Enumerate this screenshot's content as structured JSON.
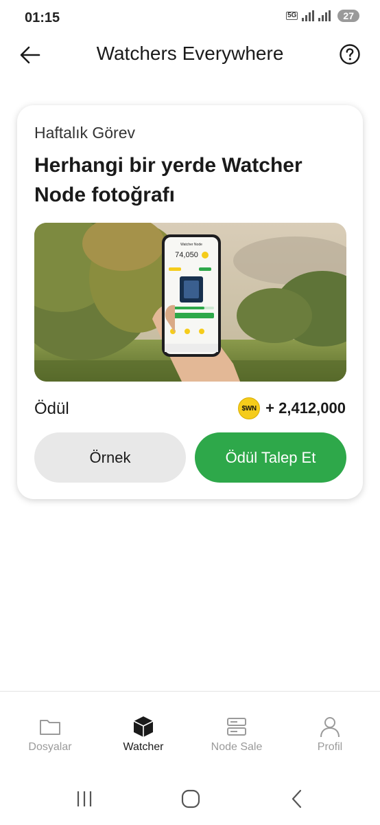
{
  "status_bar": {
    "time": "01:15",
    "network": "5G",
    "battery": "27"
  },
  "app_bar": {
    "title": "Watchers Everywhere",
    "back_icon": "arrow-left-icon",
    "help_icon": "question-circle-icon"
  },
  "card": {
    "kicker": "Haftalık Görev",
    "title": "Herhangi bir yerde Watcher Node fotoğrafı",
    "image": {
      "phone_screen_title": "Watcher Node",
      "phone_balance": "74,050"
    },
    "reward_label": "Ödül",
    "reward_token": "$WN",
    "reward_amount": "+ 2,412,000",
    "example_button": "Örnek",
    "claim_button": "Ödül Talep Et"
  },
  "bottom_nav": {
    "items": [
      {
        "label": "Dosyalar",
        "icon": "folder-icon",
        "active": false
      },
      {
        "label": "Watcher",
        "icon": "cube-icon",
        "active": true
      },
      {
        "label": "Node Sale",
        "icon": "server-icon",
        "active": false
      },
      {
        "label": "Profil",
        "icon": "user-icon",
        "active": false
      }
    ]
  },
  "colors": {
    "accent_green": "#2ea84a",
    "secondary_button": "#e8e8e8",
    "coin_yellow": "#f5cc1b",
    "inactive_nav": "#9a9a9a"
  }
}
